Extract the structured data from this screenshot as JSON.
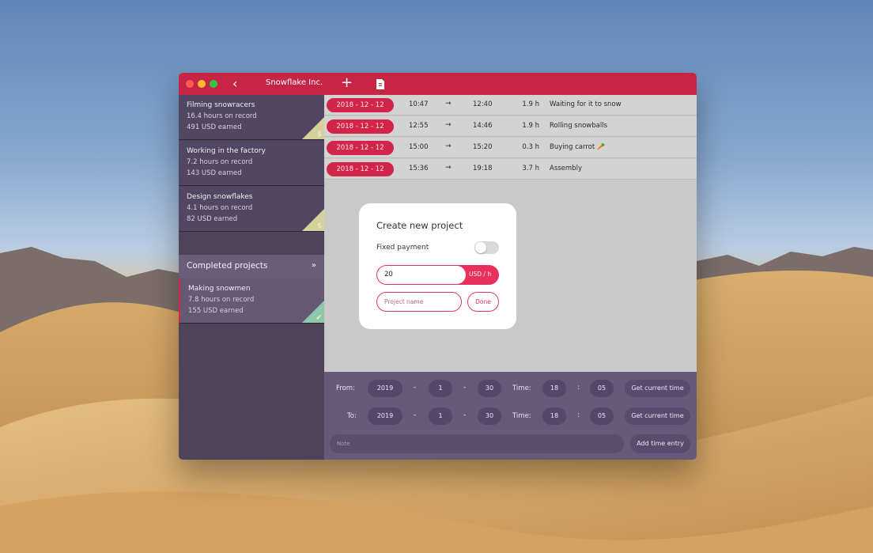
{
  "window": {
    "title": "Snowflake Inc.",
    "back_icon": "chevron-left-icon",
    "add_icon": "plus-icon",
    "export_icon": "file-icon"
  },
  "colors": {
    "accent": "#c72546",
    "sidebar": "#4e4459",
    "panel": "#675a78"
  },
  "sidebar": {
    "projects": [
      {
        "name": "Filming snowracers",
        "hours": "16.4 hours on record",
        "earned": "491 USD earned",
        "corner_icon": "dollar-icon",
        "corner_glyph": "$"
      },
      {
        "name": "Working in the factory",
        "hours": "7.2 hours on record",
        "earned": "143 USD earned"
      },
      {
        "name": "Design snowflakes",
        "hours": "4.1 hours on record",
        "earned": "82 USD earned",
        "corner_icon": "dollar-icon",
        "corner_glyph": "$"
      }
    ],
    "completed_header": "Completed projects",
    "completed_icon": "double-chevron-down-icon",
    "completed": [
      {
        "name": "Making snowmen",
        "hours": "7.8 hours on record",
        "earned": "155 USD earned",
        "corner_icon": "checkmark-icon",
        "corner_glyph": "✔"
      }
    ]
  },
  "entries": [
    {
      "date": "2018 - 12 - 12",
      "start": "10:47",
      "arrow": "→",
      "end": "12:40",
      "duration": "1.9 h",
      "description": "Waiting for it to snow"
    },
    {
      "date": "2018 - 12 - 12",
      "start": "12:55",
      "arrow": "→",
      "end": "14:46",
      "duration": "1.9 h",
      "description": "Rolling snowballs"
    },
    {
      "date": "2018 - 12 - 12",
      "start": "15:00",
      "arrow": "→",
      "end": "15:20",
      "duration": "0.3 h",
      "description": "Buying carrot 🥕"
    },
    {
      "date": "2018 - 12 - 12",
      "start": "15:36",
      "arrow": "→",
      "end": "19:18",
      "duration": "3.7 h",
      "description": "Assembly"
    }
  ],
  "modal": {
    "title": "Create new project",
    "fixed_payment_label": "Fixed payment",
    "fixed_payment_on": false,
    "rate_value": "20",
    "rate_unit": "USD / h",
    "project_name_placeholder": "Project name",
    "done_label": "Done"
  },
  "time_form": {
    "from_label": "From:",
    "to_label": "To:",
    "time_label": "Time:",
    "date_sep": "-",
    "time_sep": ":",
    "from": {
      "year": "2019",
      "month": "1",
      "day": "30",
      "hour": "18",
      "minute": "05"
    },
    "to": {
      "year": "2019",
      "month": "1",
      "day": "30",
      "hour": "18",
      "minute": "05"
    },
    "get_current_label": "Get current time",
    "note_placeholder": "Note",
    "add_entry_label": "Add time entry"
  }
}
